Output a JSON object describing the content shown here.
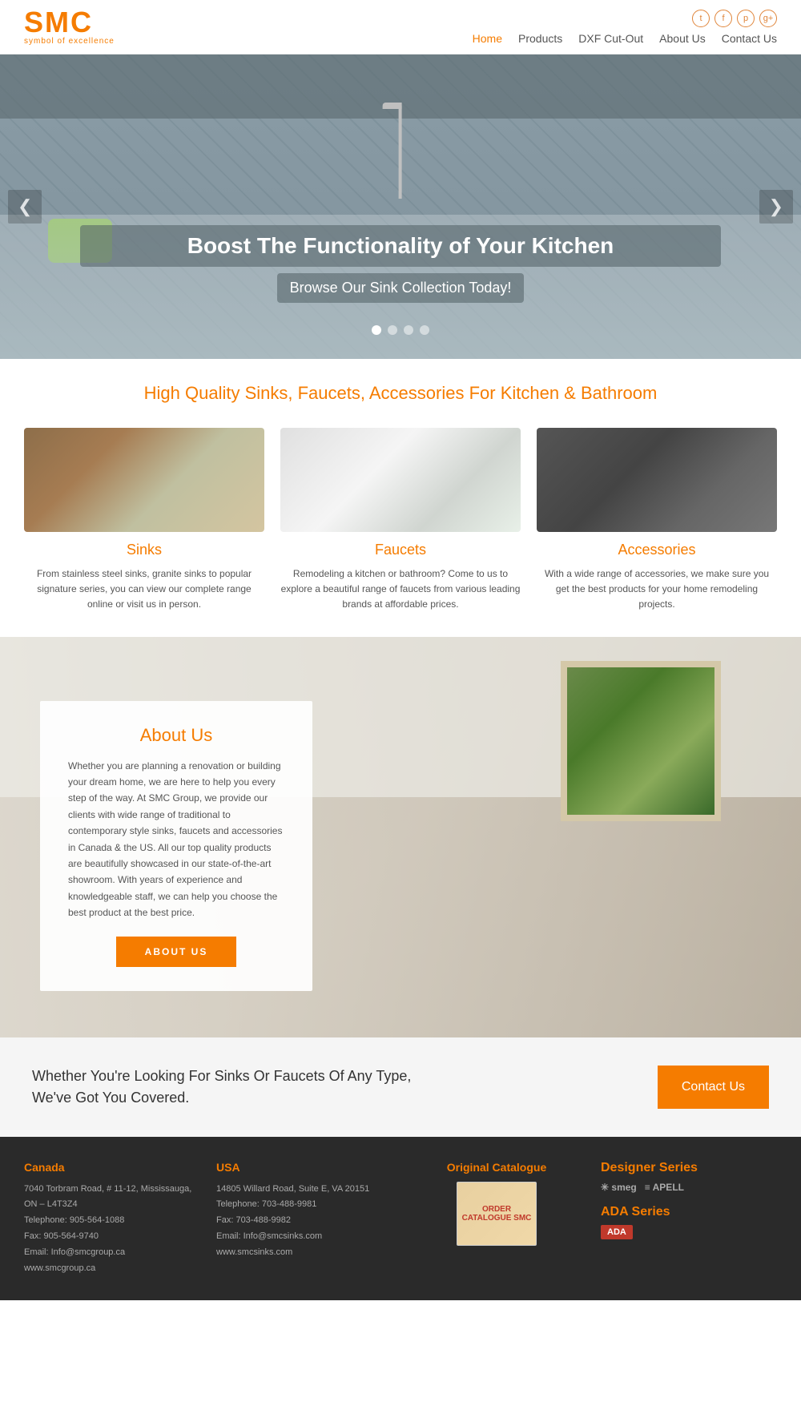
{
  "header": {
    "logo_text": "SMC",
    "logo_sub": "symbol of excellence",
    "nav": [
      {
        "label": "Home",
        "active": true
      },
      {
        "label": "Products"
      },
      {
        "label": "DXF Cut-Out"
      },
      {
        "label": "About Us"
      },
      {
        "label": "Contact Us"
      }
    ],
    "social": [
      "t",
      "f",
      "p",
      "g+"
    ]
  },
  "hero": {
    "title": "Boost The Functionality of Your Kitchen",
    "subtitle": "Browse Our Sink Collection Today!",
    "dots": [
      true,
      false,
      false,
      false
    ],
    "arrow_left": "❮",
    "arrow_right": "❯"
  },
  "tagline": {
    "text": "High Quality Sinks, Faucets, Accessories For Kitchen & Bathroom"
  },
  "products": [
    {
      "title": "Sinks",
      "desc": "From stainless steel sinks, granite sinks to popular signature series, you can view our complete range online or visit us in person.",
      "img_class": "product-img-sink"
    },
    {
      "title": "Faucets",
      "desc": "Remodeling a kitchen or bathroom? Come to us to explore a beautiful range of faucets from various leading brands at affordable prices.",
      "img_class": "product-img-faucet"
    },
    {
      "title": "Accessories",
      "desc": "With a wide range of accessories, we make sure you get the best products for your home remodeling projects.",
      "img_class": "product-img-accessories"
    }
  ],
  "about": {
    "title": "About Us",
    "text": "Whether you are planning a renovation or building your dream home, we are here to help you every step of the way. At SMC Group, we provide our clients with wide range of traditional to contemporary style sinks, faucets and accessories in Canada & the US. All our top quality products are beautifully showcased in our state-of-the-art showroom. With years of experience and knowledgeable staff, we can help you choose the best product at the best price.",
    "btn_label": "ABOUT US"
  },
  "cta": {
    "text": "Whether You're Looking For Sinks Or Faucets Of Any Type, We've Got You Covered.",
    "btn_label": "Contact Us"
  },
  "footer": {
    "canada": {
      "title": "Canada",
      "address": "7040 Torbram Road, # 11-12, Mississauga, ON – L4T3Z4",
      "phone": "Telephone: 905-564-1088",
      "fax": "Fax: 905-564-9740",
      "email": "Email: Info@smcgroup.ca",
      "website": "www.smcgroup.ca"
    },
    "usa": {
      "title": "USA",
      "address": "14805 Willard Road, Suite E, VA 20151",
      "phone": "Telephone: 703-488-9981",
      "fax": "Fax: 703-488-9982",
      "email": "Email: Info@smcsinks.com",
      "website": "www.smcsinks.com"
    },
    "catalogue": {
      "title": "Original Catalogue",
      "img_text": "ORDER CATALOGUE SMC"
    },
    "brands": {
      "designer_label": "Designer Series",
      "smeg": "✳ smeg",
      "apell": "≡ APELL",
      "ada_label": "ADA Series",
      "ada_badge": "ADA"
    }
  }
}
